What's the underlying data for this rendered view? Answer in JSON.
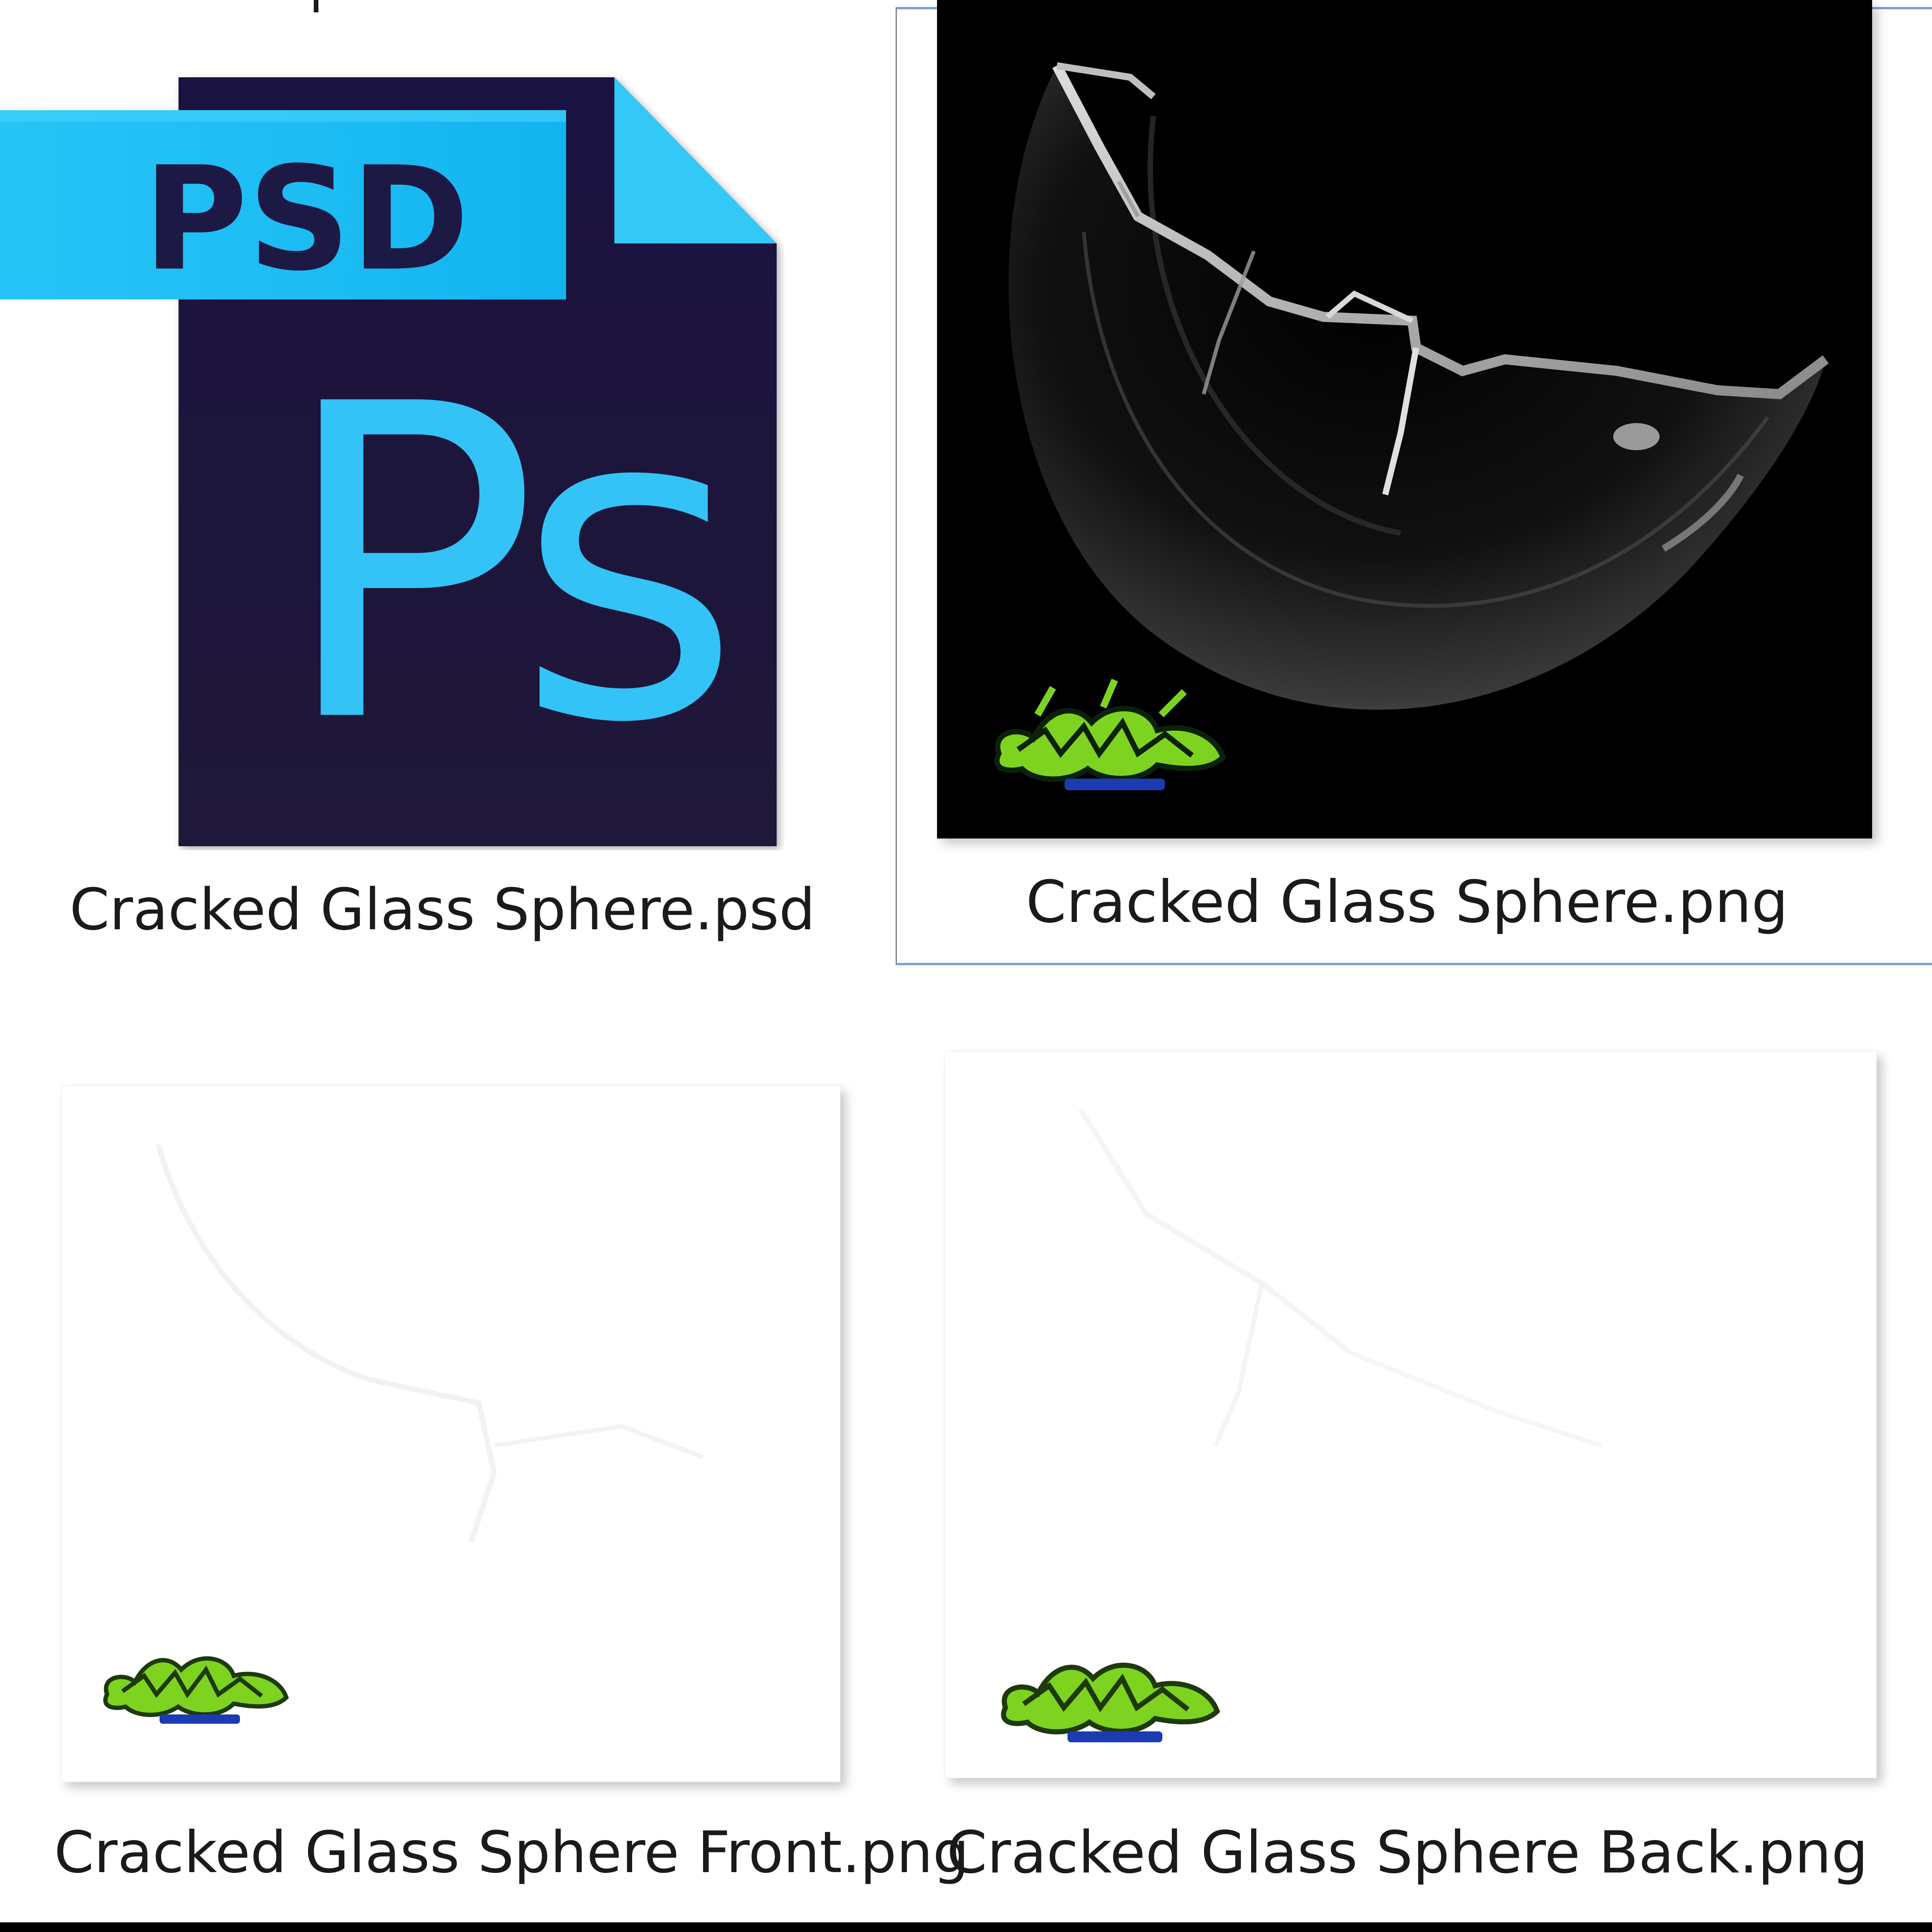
{
  "files": [
    {
      "name": "Cracked Glass Sphere.psd",
      "type": "psd-icon",
      "icon_badge": "PSD",
      "icon_mark": "Ps",
      "selected": false
    },
    {
      "name": "Cracked Glass Sphere.png",
      "type": "image-thumbnail",
      "background": "black",
      "selected": true
    },
    {
      "name": "Cracked Glass Sphere Front.png",
      "type": "image-thumbnail",
      "background": "white",
      "selected": false
    },
    {
      "name": "Cracked Glass Sphere Back.png",
      "type": "image-thumbnail",
      "background": "white",
      "selected": false
    }
  ],
  "colors": {
    "psd_dark": "#1c1538",
    "psd_light": "#2ec5f5",
    "psd_badge": "#20bff4",
    "selection_border": "#7da2ce",
    "watermark_green": "#7ed321",
    "watermark_blue": "#1b3bb0"
  }
}
